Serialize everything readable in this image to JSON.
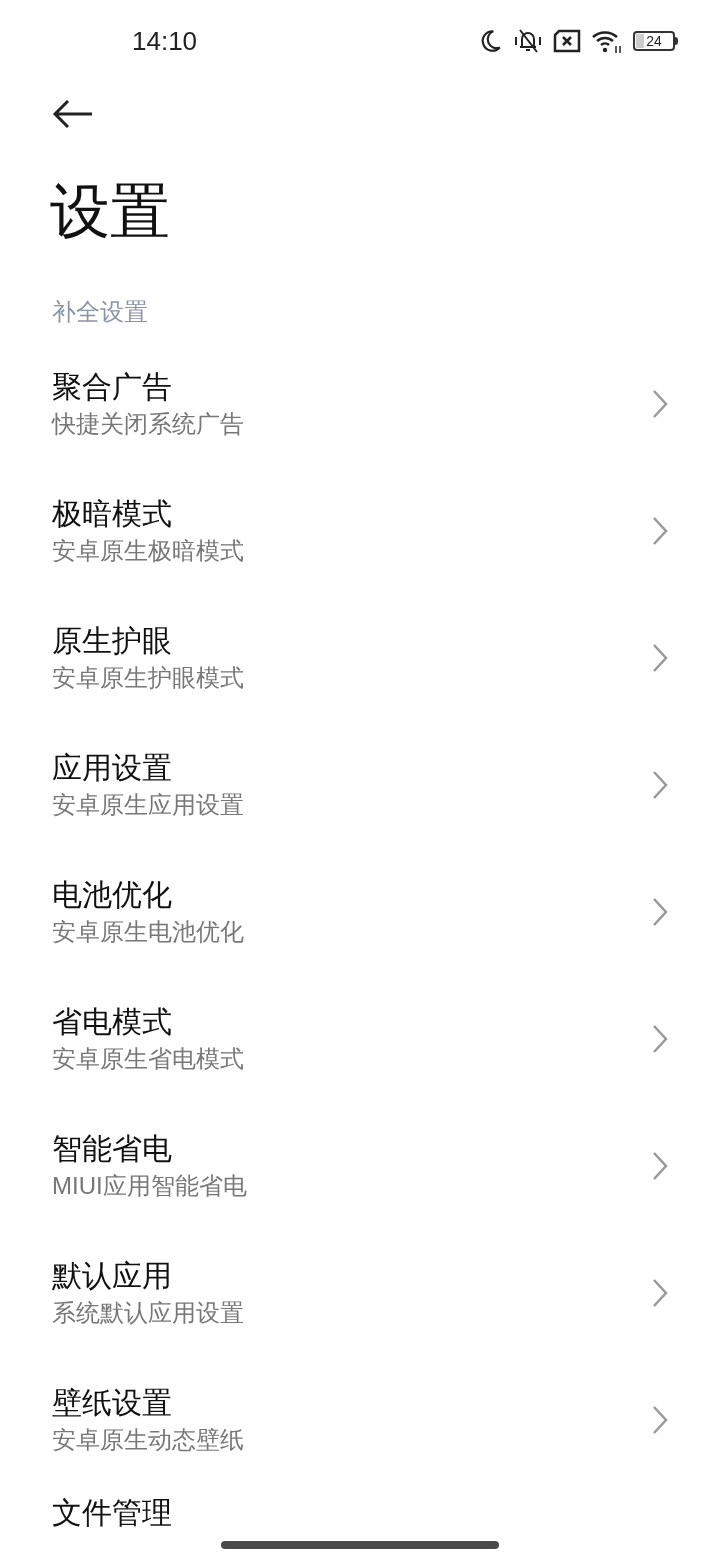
{
  "status_bar": {
    "time": "14:10",
    "battery": "24"
  },
  "header": {
    "title": "设置"
  },
  "section": {
    "title": "补全设置"
  },
  "items": [
    {
      "title": "聚合广告",
      "subtitle": "快捷关闭系统广告"
    },
    {
      "title": "极暗模式",
      "subtitle": "安卓原生极暗模式"
    },
    {
      "title": "原生护眼",
      "subtitle": "安卓原生护眼模式"
    },
    {
      "title": "应用设置",
      "subtitle": "安卓原生应用设置"
    },
    {
      "title": "电池优化",
      "subtitle": "安卓原生电池优化"
    },
    {
      "title": "省电模式",
      "subtitle": "安卓原生省电模式"
    },
    {
      "title": "智能省电",
      "subtitle": "MIUI应用智能省电"
    },
    {
      "title": "默认应用",
      "subtitle": "系统默认应用设置"
    },
    {
      "title": "壁纸设置",
      "subtitle": "安卓原生动态壁纸"
    },
    {
      "title": "文件管理"
    }
  ]
}
